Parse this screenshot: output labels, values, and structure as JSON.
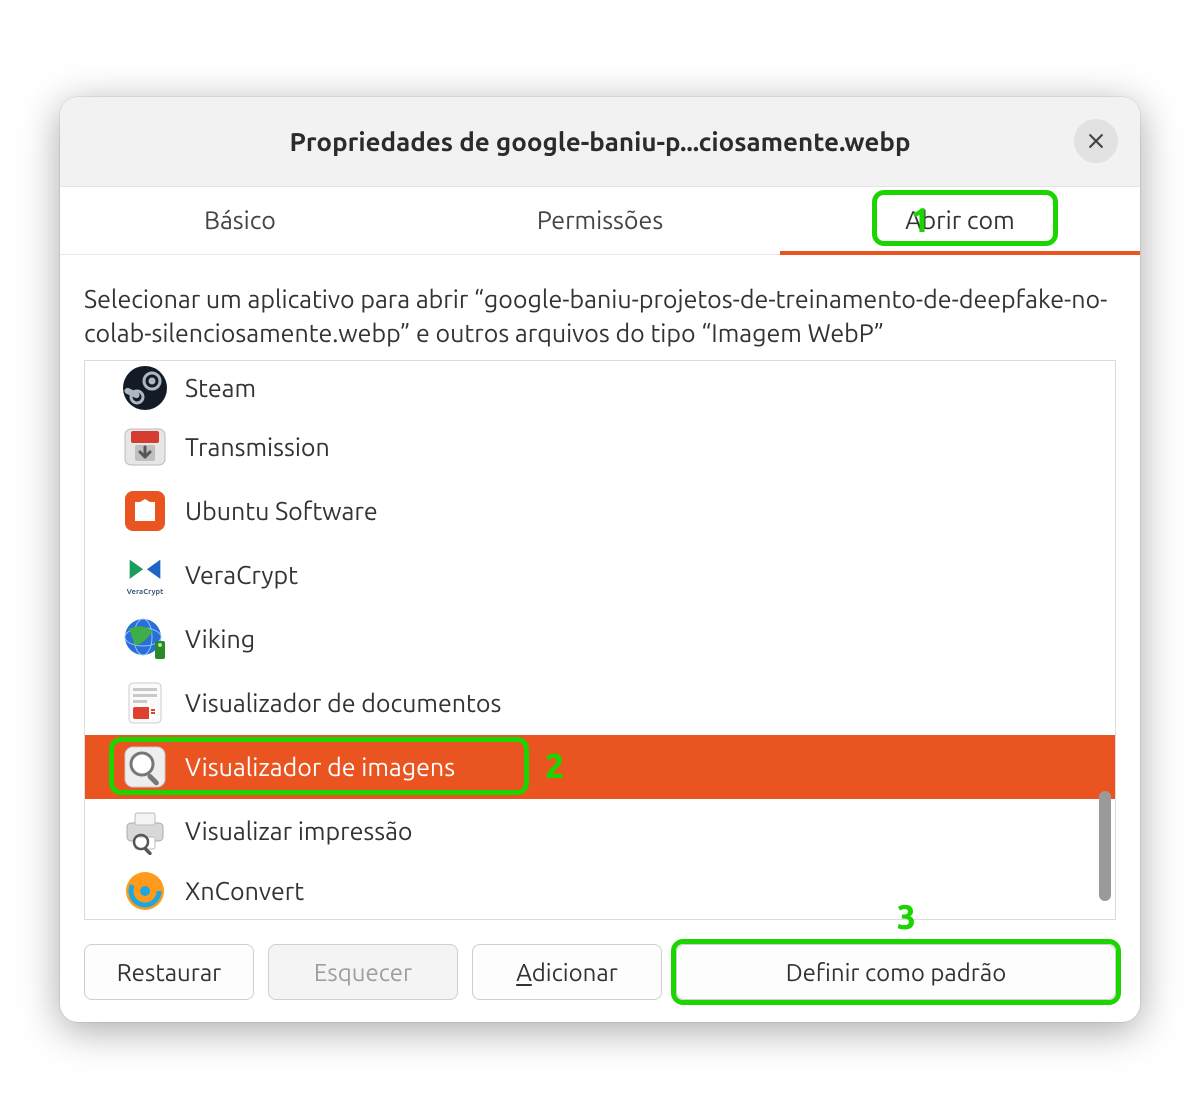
{
  "header": {
    "title": "Propriedades de google-baniu-p...ciosamente.webp"
  },
  "tabs": {
    "basic": "Básico",
    "permissions": "Permissões",
    "open_with": "Abrir com",
    "active": "open_with"
  },
  "description": "Selecionar um aplicativo para abrir “google-baniu-projetos-de-treinamento-de-deepfake-no-colab-silenciosamente.webp” e outros arquivos do tipo “Imagem WebP”",
  "apps": [
    {
      "name": "Steam",
      "icon": "steam",
      "selected": false
    },
    {
      "name": "Transmission",
      "icon": "transmission",
      "selected": false
    },
    {
      "name": "Ubuntu Software",
      "icon": "ubuntu-sw",
      "selected": false
    },
    {
      "name": "VeraCrypt",
      "icon": "veracrypt",
      "selected": false
    },
    {
      "name": "Viking",
      "icon": "viking",
      "selected": false
    },
    {
      "name": "Visualizador de documentos",
      "icon": "evince",
      "selected": false
    },
    {
      "name": "Visualizador de imagens",
      "icon": "eog",
      "selected": true
    },
    {
      "name": "Visualizar impressão",
      "icon": "print-prev",
      "selected": false
    },
    {
      "name": "XnConvert",
      "icon": "xnconvert",
      "selected": false
    }
  ],
  "buttons": {
    "restore": "Restaurar",
    "forget": "Esquecer",
    "add": "Adicionar",
    "default": "Definir como padrão"
  },
  "annotations": {
    "n1": "1",
    "n2": "2",
    "n3": "3"
  }
}
